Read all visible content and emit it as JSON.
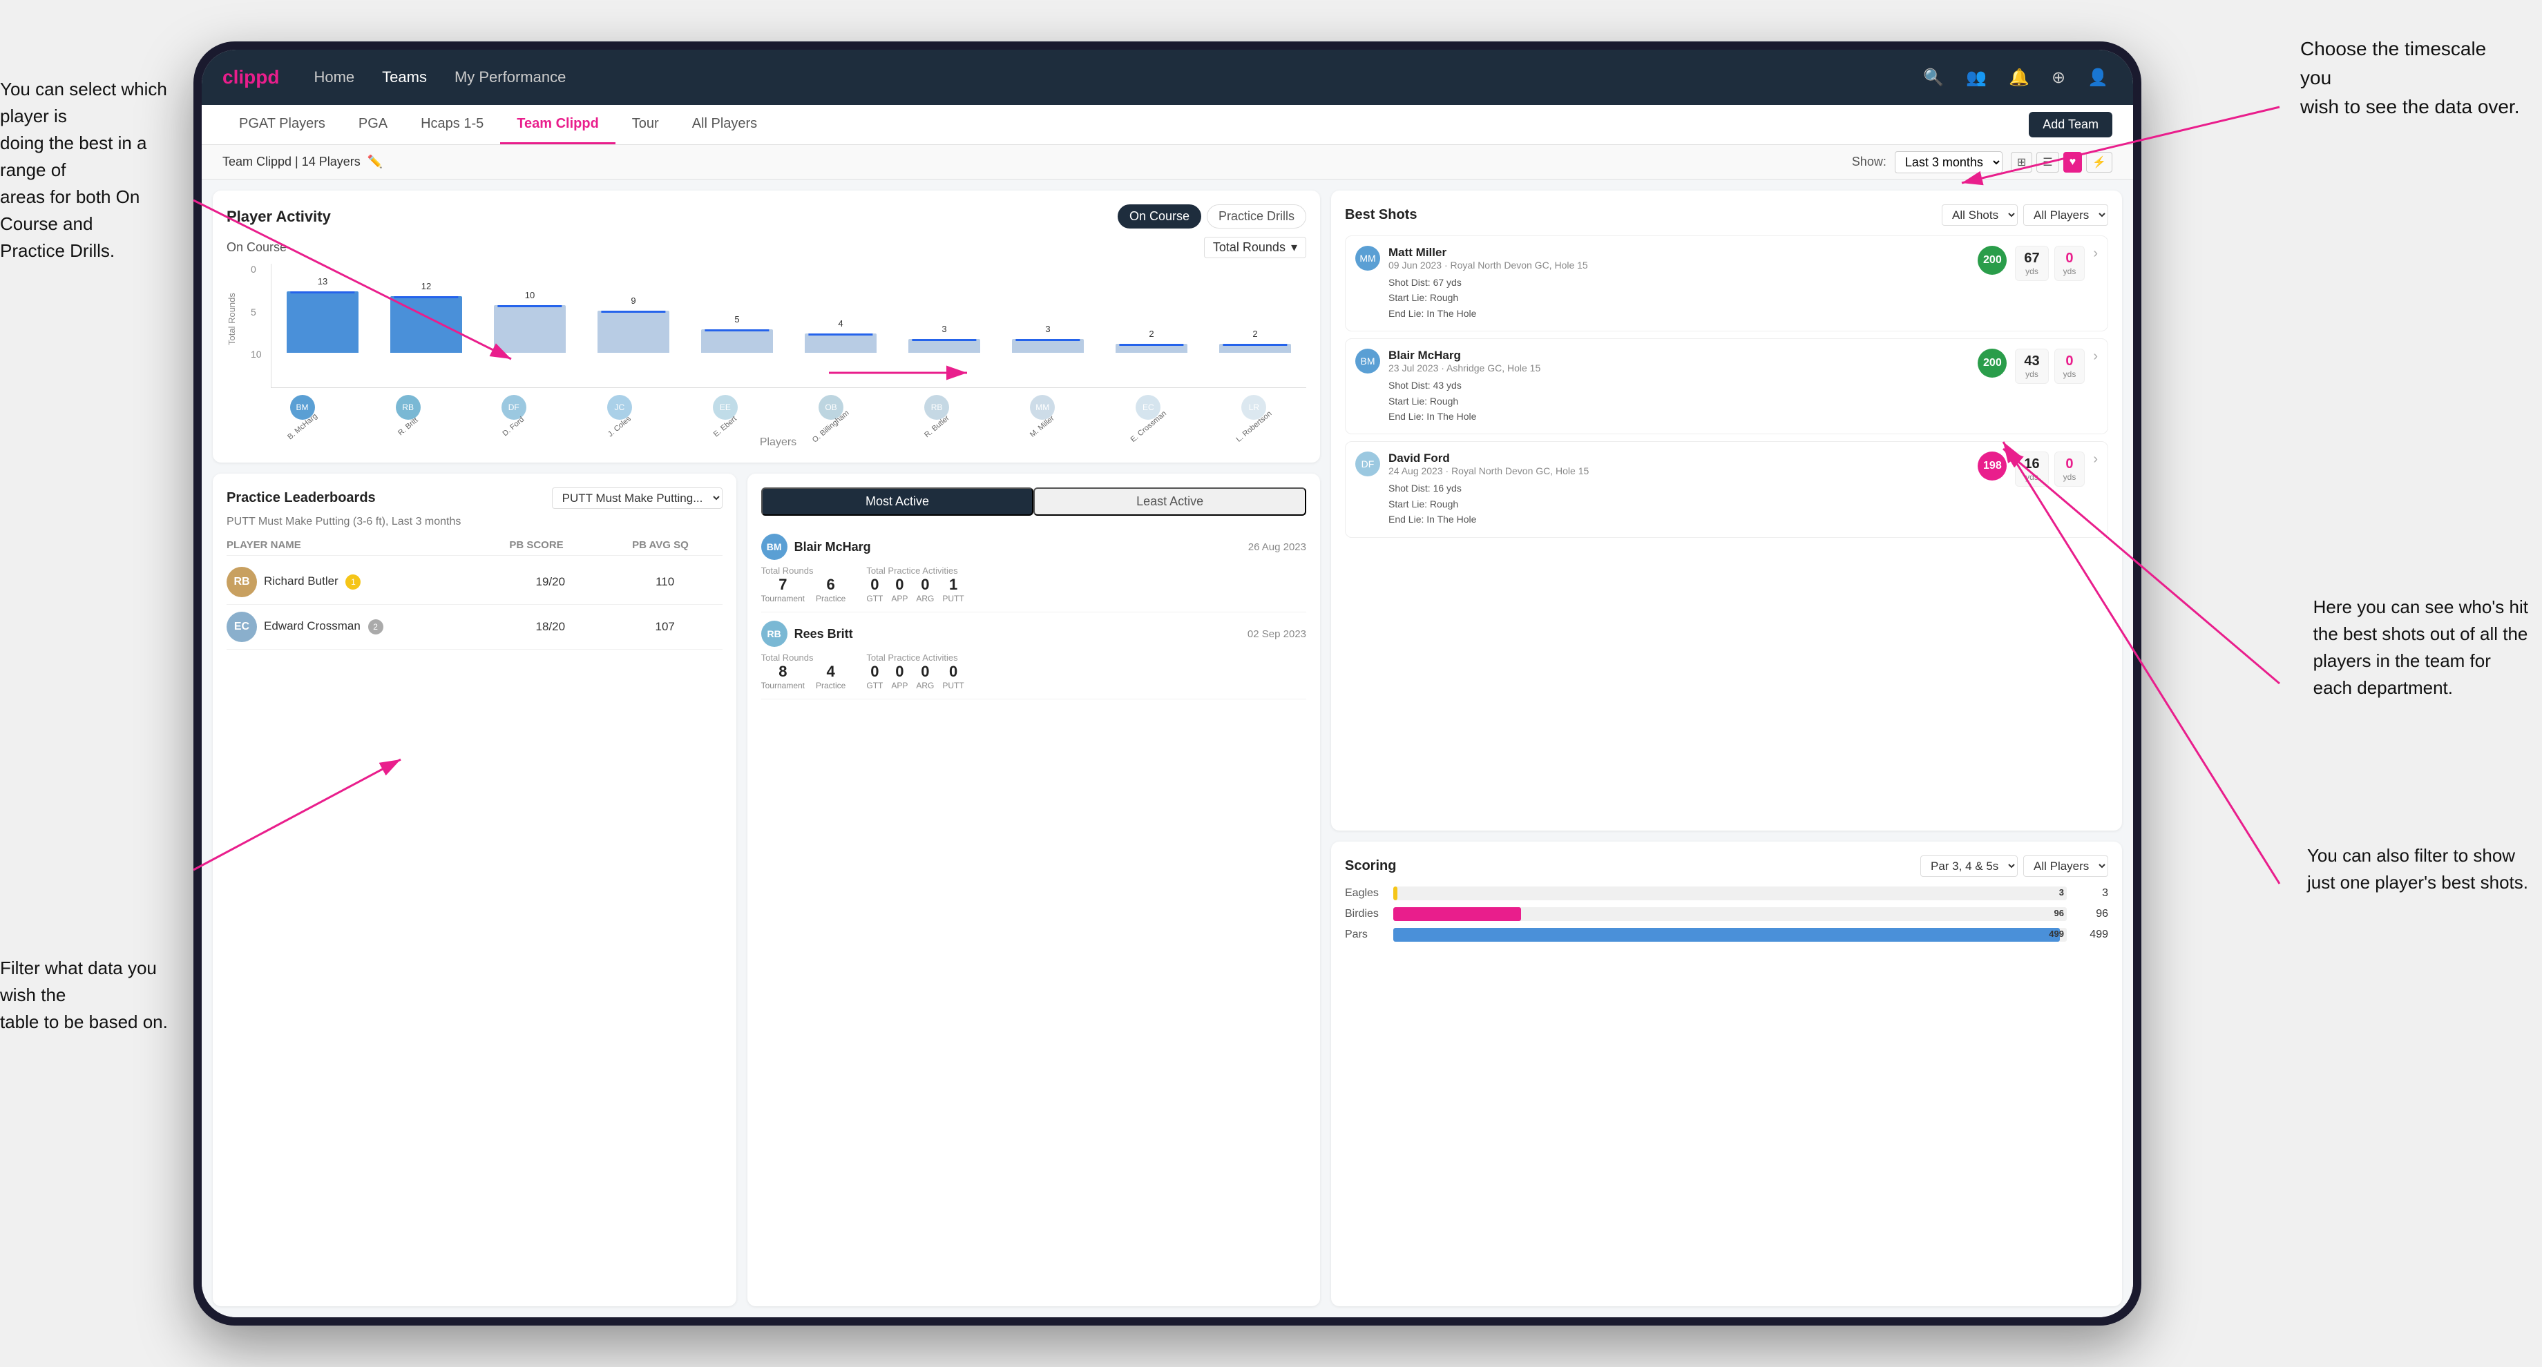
{
  "annotations": {
    "top_right": "Choose the timescale you\nwish to see the data over.",
    "top_left": "You can select which player is\ndoing the best in a range of\nareas for both On Course and\nPractice Drills.",
    "bottom_left": "Filter what data you wish the\ntable to be based on.",
    "bottom_right_top": "Here you can see who's hit\nthe best shots out of all the\nplayers in the team for\neach department.",
    "bottom_right_bottom": "You can also filter to show\njust one player's best shots."
  },
  "nav": {
    "logo": "clippd",
    "links": [
      "Home",
      "Teams",
      "My Performance"
    ],
    "active_link": "Teams"
  },
  "sub_tabs": {
    "tabs": [
      "PGAT Players",
      "PGA",
      "Hcaps 1-5",
      "Team Clippd",
      "Tour",
      "All Players"
    ],
    "active": "Team Clippd",
    "add_btn": "Add Team"
  },
  "team_header": {
    "name": "Team Clippd | 14 Players",
    "show_label": "Show:",
    "show_value": "Last 3 months",
    "view_options": [
      "grid",
      "list",
      "heart",
      "chart"
    ]
  },
  "player_activity": {
    "title": "Player Activity",
    "tabs": [
      "On Course",
      "Practice Drills"
    ],
    "active_tab": "On Course",
    "chart_title": "On Course",
    "chart_filter": "Total Rounds",
    "y_axis": [
      "0",
      "5",
      "10"
    ],
    "bars": [
      {
        "label": "13",
        "height": 100,
        "name": "B. McHarg",
        "highlight": true
      },
      {
        "label": "12",
        "height": 92,
        "name": "R. Britt",
        "highlight": true
      },
      {
        "label": "10",
        "height": 77,
        "name": "D. Ford",
        "highlight": false
      },
      {
        "label": "9",
        "height": 69,
        "name": "J. Coles",
        "highlight": false
      },
      {
        "label": "5",
        "height": 38,
        "name": "E. Ebert",
        "highlight": false
      },
      {
        "label": "4",
        "height": 31,
        "name": "O. Billingham",
        "highlight": false
      },
      {
        "label": "3",
        "height": 23,
        "name": "R. Butler",
        "highlight": false
      },
      {
        "label": "3",
        "height": 23,
        "name": "M. Miller",
        "highlight": false
      },
      {
        "label": "2",
        "height": 15,
        "name": "E. Crossman",
        "highlight": false
      },
      {
        "label": "2",
        "height": 15,
        "name": "L. Robertson",
        "highlight": false
      }
    ],
    "x_axis_label": "Players"
  },
  "practice_leaderboard": {
    "title": "Practice Leaderboards",
    "drill": "PUTT Must Make Putting...",
    "subtitle": "PUTT Must Make Putting (3-6 ft), Last 3 months",
    "headers": [
      "PLAYER NAME",
      "PB SCORE",
      "PB AVG SQ"
    ],
    "rows": [
      {
        "name": "Richard Butler",
        "badge": "1",
        "badge_type": "gold",
        "pb_score": "19/20",
        "pb_avg": "110"
      },
      {
        "name": "Edward Crossman",
        "badge": "2",
        "badge_type": "silver",
        "pb_score": "18/20",
        "pb_avg": "107"
      }
    ]
  },
  "most_active": {
    "tabs": [
      "Most Active",
      "Least Active"
    ],
    "active_tab": "Most Active",
    "players": [
      {
        "name": "Blair McHarg",
        "date": "26 Aug 2023",
        "total_rounds_label": "Total Rounds",
        "tournament": "7",
        "practice": "6",
        "total_practice_label": "Total Practice Activities",
        "gtt": "0",
        "app": "0",
        "arg": "0",
        "putt": "1"
      },
      {
        "name": "Rees Britt",
        "date": "02 Sep 2023",
        "total_rounds_label": "Total Rounds",
        "tournament": "8",
        "practice": "4",
        "total_practice_label": "Total Practice Activities",
        "gtt": "0",
        "app": "0",
        "arg": "0",
        "putt": "0"
      }
    ]
  },
  "best_shots": {
    "title": "Best Shots",
    "filters": [
      "All Shots",
      "All Players"
    ],
    "shots": [
      {
        "player": "Matt Miller",
        "location": "09 Jun 2023 · Royal North Devon GC, Hole 15",
        "badge_num": "200",
        "badge_type": "green",
        "dist": "Shot Dist: 67 yds",
        "start_lie": "Start Lie: Rough",
        "end_lie": "End Lie: In The Hole",
        "stat1_val": "67",
        "stat1_unit": "yds",
        "stat2_val": "0",
        "stat2_unit": "yds"
      },
      {
        "player": "Blair McHarg",
        "location": "23 Jul 2023 · Ashridge GC, Hole 15",
        "badge_num": "200",
        "badge_type": "green",
        "dist": "Shot Dist: 43 yds",
        "start_lie": "Start Lie: Rough",
        "end_lie": "End Lie: In The Hole",
        "stat1_val": "43",
        "stat1_unit": "yds",
        "stat2_val": "0",
        "stat2_unit": "yds"
      },
      {
        "player": "David Ford",
        "location": "24 Aug 2023 · Royal North Devon GC, Hole 15",
        "badge_num": "198",
        "badge_type": "pink",
        "dist": "Shot Dist: 16 yds",
        "start_lie": "Start Lie: Rough",
        "end_lie": "End Lie: In The Hole",
        "stat1_val": "16",
        "stat1_unit": "yds",
        "stat2_val": "0",
        "stat2_unit": "yds"
      }
    ]
  },
  "scoring": {
    "title": "Scoring",
    "filters": [
      "Par 3, 4 & 5s",
      "All Players"
    ],
    "rows": [
      {
        "label": "Eagles",
        "value": 3,
        "max": 500,
        "color": "#f5c518"
      },
      {
        "label": "Birdies",
        "value": 96,
        "max": 500,
        "color": "#e91e8c"
      },
      {
        "label": "Pars",
        "value": 499,
        "max": 500,
        "color": "#4a90d9"
      }
    ]
  },
  "colors": {
    "brand_pink": "#e91e8c",
    "nav_bg": "#1e2d3d",
    "active_bar": "#4a90d9",
    "inactive_bar": "#b8cce4"
  }
}
